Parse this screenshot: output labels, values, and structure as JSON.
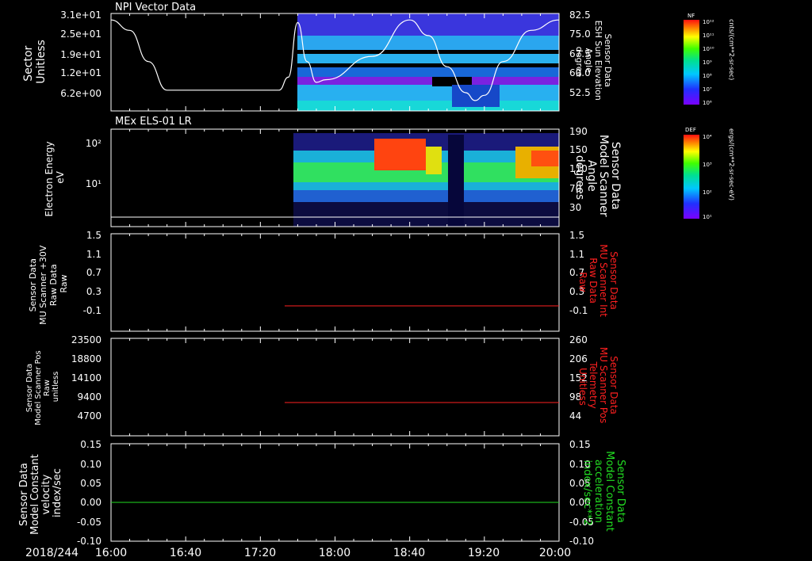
{
  "colors": {
    "background": "#000000",
    "axis": "#ffffff",
    "red_trace": "#ff2020",
    "green_trace": "#22dd22",
    "red_label": "#ff2020",
    "green_label": "#22dd22"
  },
  "time_axis": {
    "date_label": "2018/244",
    "ticks": [
      "16:00",
      "16:40",
      "17:20",
      "18:00",
      "18:40",
      "19:20",
      "20:00"
    ],
    "start_minutes": 960,
    "end_minutes": 1200
  },
  "chart_data": [
    {
      "type": "heatmap",
      "title": "NPI Vector Data",
      "left_axis": {
        "label_lines": [
          "Sector",
          "Unitless"
        ],
        "ticks": [
          "3.1e+01",
          "2.5e+01",
          "1.9e+01",
          "1.2e+01",
          "6.2e+00"
        ],
        "range": [
          0,
          31
        ]
      },
      "right_axis": {
        "label_lines": [
          "Sensor Data",
          "ESH Sun Elevation",
          "Angle",
          "degree"
        ],
        "ticks": [
          "82.5",
          "75.0",
          "67.5",
          "60.0",
          "52.5"
        ],
        "range": [
          45,
          82.5
        ]
      },
      "colorbar": {
        "name": "NF",
        "units": "cnts/(cm**2-sr-sec)",
        "labels": [
          "10¹²",
          "10¹¹",
          "10¹⁰",
          "10⁹",
          "10⁸",
          "10⁷",
          "10⁶"
        ]
      },
      "data_start_time": "17:30",
      "sun_elevation_curve": {
        "time": [
          "16:00",
          "16:10",
          "16:20",
          "16:30",
          "17:00",
          "17:30",
          "17:35",
          "17:40",
          "17:45",
          "17:50",
          "17:55",
          "18:20",
          "18:40",
          "18:50",
          "19:00",
          "19:10",
          "19:15",
          "19:20",
          "19:30",
          "19:45",
          "20:00"
        ],
        "elevation": [
          80,
          76,
          64,
          53,
          53,
          53,
          58,
          79,
          64,
          56,
          57,
          66,
          80,
          74,
          62,
          52,
          49,
          51,
          64,
          76,
          80
        ]
      }
    },
    {
      "type": "heatmap",
      "title": "MEx ELS-01 LR",
      "left_axis": {
        "label_lines": [
          "Electron Energy",
          "eV"
        ],
        "ticks": [
          "10²",
          "10¹"
        ],
        "scale": "log"
      },
      "right_axis": {
        "label_lines": [
          "Sensor Data",
          "Model Scanner",
          "Angle",
          "degrees"
        ],
        "ticks": [
          "190",
          "150",
          "110",
          "70",
          "30"
        ],
        "range": [
          0,
          190
        ]
      },
      "colorbar": {
        "name": "DEF",
        "units": "ergs/(cm**2-sr-sec-eV)",
        "labels": [
          "10⁴",
          "10³",
          "10²",
          "10¹"
        ]
      },
      "data_start_time": "17:28",
      "scanner_angle_line": {
        "time": [
          "16:00",
          "20:00"
        ],
        "angle": 14
      }
    },
    {
      "type": "line",
      "left_axis": {
        "label_lines": [
          "Sensor Data",
          "MU Scanner +30V",
          "Raw Data",
          "Raw"
        ],
        "ticks": [
          "1.5",
          "1.1",
          "0.7",
          "0.3",
          "-0.1"
        ],
        "range": [
          -0.5,
          1.5
        ]
      },
      "right_axis": {
        "label_lines": [
          "Sensor Data",
          "MU Scanner Int",
          "Raw Data",
          "Raw"
        ],
        "ticks": [
          "1.5",
          "1.1",
          "0.7",
          "0.3",
          "-0.1"
        ],
        "range": [
          -0.5,
          1.5
        ]
      },
      "series": [
        {
          "time": [
            "17:20",
            "20:00"
          ],
          "values": [
            0,
            0
          ],
          "color": "red"
        }
      ]
    },
    {
      "type": "line",
      "left_axis": {
        "label_lines": [
          "Sensor Data",
          "Model Scanner Pos",
          "Raw",
          "unitless"
        ],
        "ticks": [
          "23500",
          "18800",
          "14100",
          "9400",
          "4700"
        ],
        "range": [
          0,
          23500
        ]
      },
      "right_axis": {
        "label_lines": [
          "Sensor Data",
          "MU Scanner Pos",
          "Telemetry",
          "Unitless"
        ],
        "ticks": [
          "260",
          "206",
          "152",
          "98",
          "44"
        ],
        "range": [
          0,
          260
        ]
      },
      "series": [
        {
          "time": [
            "17:20",
            "20:00"
          ],
          "values": [
            85,
            85
          ],
          "axis": "right",
          "color": "red"
        }
      ]
    },
    {
      "type": "line",
      "left_axis": {
        "label_lines": [
          "Sensor Data",
          "Model Constant",
          "velocity",
          "index/sec"
        ],
        "ticks": [
          "0.15",
          "0.10",
          "0.05",
          "0.00",
          "-0.05",
          "-0.10"
        ],
        "range": [
          -0.1,
          0.15
        ]
      },
      "right_axis": {
        "label_lines": [
          "Sensor Data",
          "Model Constant",
          "acceleration",
          "index/sec**2"
        ],
        "ticks": [
          "0.15",
          "0.10",
          "0.05",
          "0.00",
          "-0.05",
          "-0.10"
        ],
        "range": [
          -0.1,
          0.15
        ]
      },
      "series": [
        {
          "time": [
            "16:00",
            "20:00"
          ],
          "values": [
            0,
            0
          ],
          "color": "green"
        }
      ]
    }
  ]
}
